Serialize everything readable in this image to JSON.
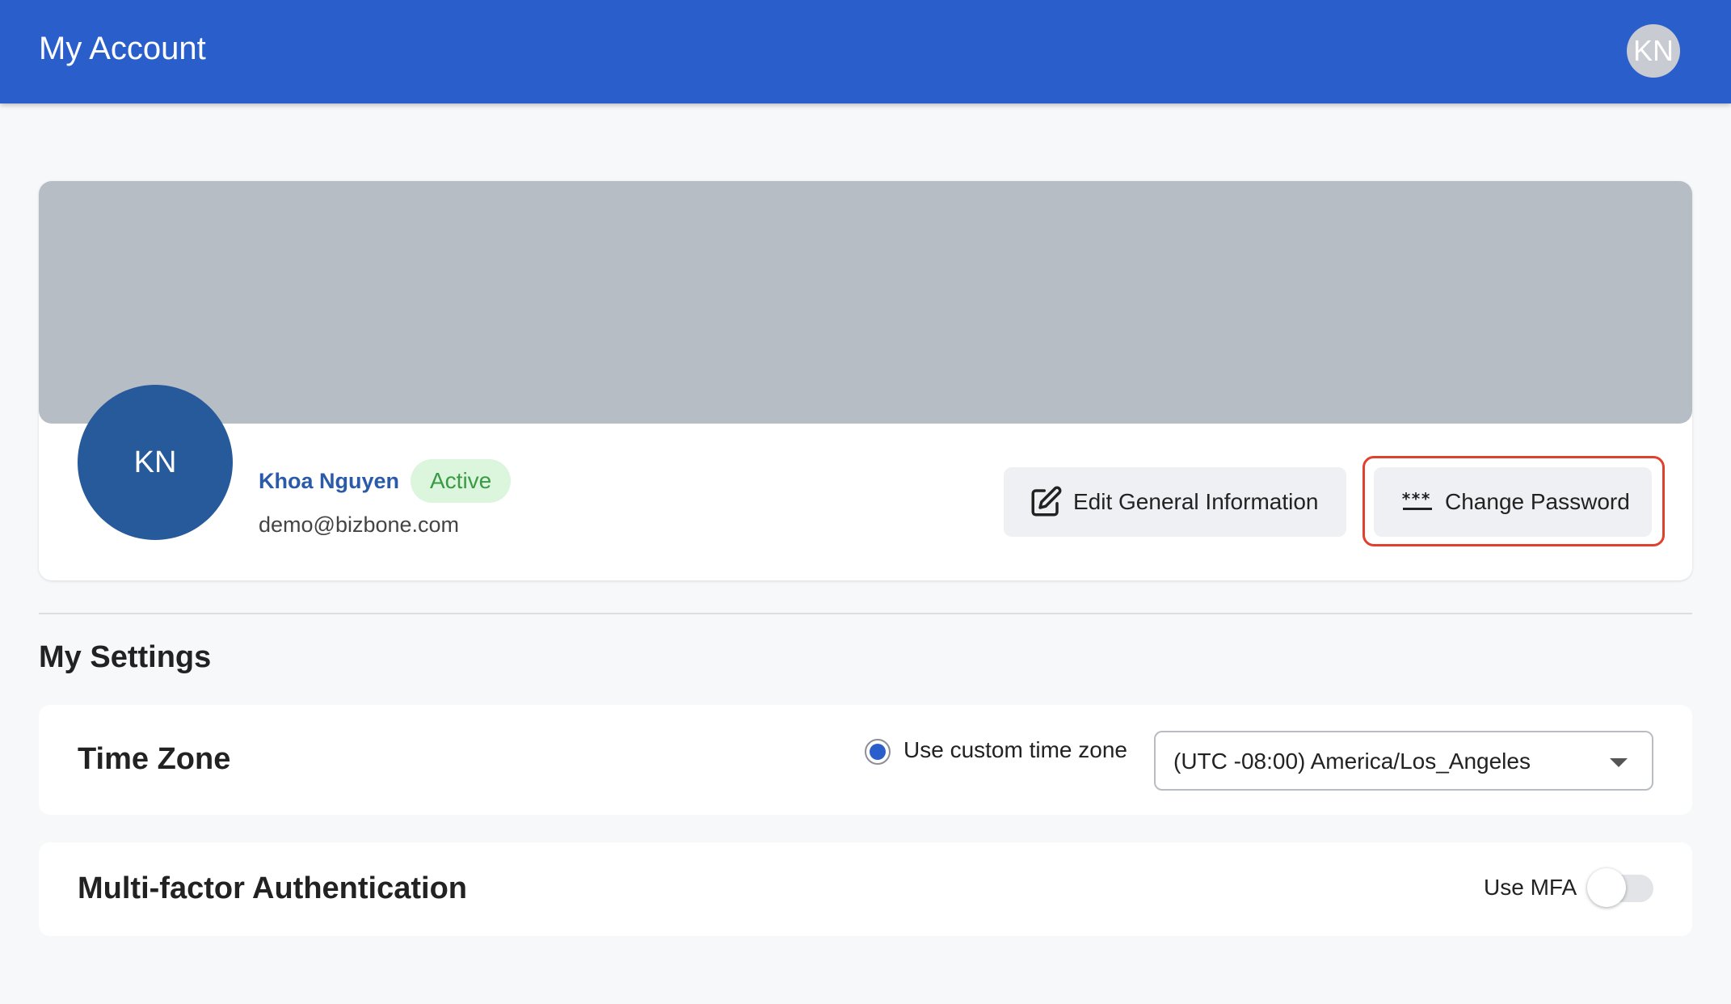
{
  "header": {
    "title": "My Account",
    "avatar_initials": "KN",
    "color": "#2a5fcb"
  },
  "profile": {
    "avatar_initials": "KN",
    "name": "Khoa Nguyen",
    "status": "Active",
    "email": "demo@bizbone.com",
    "edit_button_label": "Edit General Information",
    "edit_button_icon": "edit-icon",
    "change_password_label": "Change Password",
    "change_password_icon": "password-icon",
    "highlight_color": "#e0402e"
  },
  "settings": {
    "title": "My Settings",
    "time_zone": {
      "title": "Time Zone",
      "radio_label": "Use custom time zone",
      "radio_selected": true,
      "selected_value": "(UTC -08:00) America/Los_Angeles"
    },
    "mfa": {
      "title": "Multi-factor Authentication",
      "toggle_label": "Use MFA",
      "enabled": false
    }
  }
}
